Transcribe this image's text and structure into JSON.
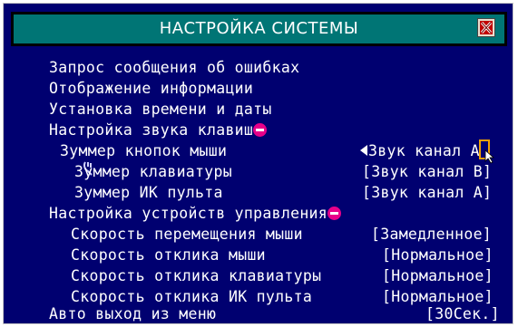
{
  "window": {
    "title": "НАСТРОЙКА СИСТЕМЫ",
    "close_icon": "close-icon"
  },
  "menu": {
    "error_request": "Запрос сообщения об ошибках",
    "display_info": "Отображение информации",
    "set_time_date": "Установка времени и даты",
    "key_sound": "Настройка звука клавиш",
    "mouse_buzzer": "Зуммер кнопок мыши",
    "mouse_buzzer_value": "Звук канал А",
    "kbd_buzzer": "Зуммер клавиатуры",
    "kbd_buzzer_value": "[Звук канал В]",
    "ir_buzzer": "Зуммер ИК пульта",
    "ir_buzzer_value": "[Звук канал А]",
    "control_devices": "Настройка устройств управления",
    "mouse_speed": "Скорость перемещения мыши",
    "mouse_speed_value": "[Замедленное]",
    "mouse_response": "Скорость отклика мыши",
    "mouse_response_value": "[Нормальное]",
    "kbd_response": "Скорость отклика клавиатуры",
    "kbd_response_value": "[Нормальное]",
    "ir_response": "Скорость отклика ИК пульта",
    "ir_response_value": "[Нормальное]",
    "auto_exit": "Авто выход из меню",
    "auto_exit_value": "[30Сек.]"
  },
  "colors": {
    "background": "#000070",
    "title_bar": "#007575",
    "collapse_badge": "#e8008a"
  }
}
